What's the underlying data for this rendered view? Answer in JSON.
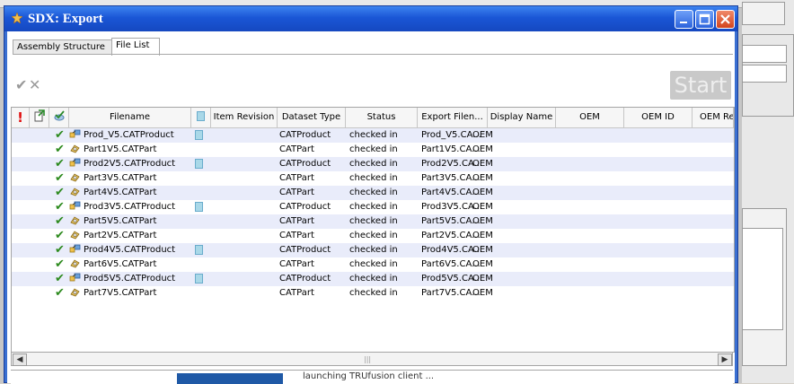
{
  "dialog": {
    "title": "SDX: Export",
    "icons": {
      "app": "star-icon",
      "minimize": "minimize-icon",
      "maximize": "maximize-icon",
      "close": "close-icon"
    }
  },
  "tabs": [
    {
      "label": "Assembly Structure",
      "active": false
    },
    {
      "label": "File List",
      "active": true
    }
  ],
  "toolbar": {
    "check_icon": "check-icon",
    "cross_icon": "cross-icon",
    "start_label": "Start"
  },
  "table": {
    "headers": {
      "filename": "Filename",
      "item_revision": "Item Revision",
      "dataset_type": "Dataset Type",
      "status": "Status",
      "export_filename": "Export Filen...",
      "display_name": "Display Name",
      "oem": "OEM",
      "oem_id": "OEM ID",
      "oem_re": "OEM Re"
    },
    "rows": [
      {
        "filename": "Prod_V5.CATProduct",
        "has_doc": true,
        "dataset_type": "CATProduct",
        "status": "checked in",
        "export": "Prod_V5.CA...",
        "display": "OEM"
      },
      {
        "filename": "Part1V5.CATPart",
        "has_doc": false,
        "dataset_type": "CATPart",
        "status": "checked in",
        "export": "Part1V5.CA...",
        "display": "OEM"
      },
      {
        "filename": "Prod2V5.CATProduct",
        "has_doc": true,
        "dataset_type": "CATProduct",
        "status": "checked in",
        "export": "Prod2V5.CA...",
        "display": "OEM"
      },
      {
        "filename": "Part3V5.CATPart",
        "has_doc": false,
        "dataset_type": "CATPart",
        "status": "checked in",
        "export": "Part3V5.CA...",
        "display": "OEM"
      },
      {
        "filename": "Part4V5.CATPart",
        "has_doc": false,
        "dataset_type": "CATPart",
        "status": "checked in",
        "export": "Part4V5.CA...",
        "display": "OEM"
      },
      {
        "filename": "Prod3V5.CATProduct",
        "has_doc": true,
        "dataset_type": "CATProduct",
        "status": "checked in",
        "export": "Prod3V5.CA...",
        "display": "OEM"
      },
      {
        "filename": "Part5V5.CATPart",
        "has_doc": false,
        "dataset_type": "CATPart",
        "status": "checked in",
        "export": "Part5V5.CA...",
        "display": "OEM"
      },
      {
        "filename": "Part2V5.CATPart",
        "has_doc": false,
        "dataset_type": "CATPart",
        "status": "checked in",
        "export": "Part2V5.CA...",
        "display": "OEM"
      },
      {
        "filename": "Prod4V5.CATProduct",
        "has_doc": true,
        "dataset_type": "CATProduct",
        "status": "checked in",
        "export": "Prod4V5.CA...",
        "display": "OEM"
      },
      {
        "filename": "Part6V5.CATPart",
        "has_doc": false,
        "dataset_type": "CATPart",
        "status": "checked in",
        "export": "Part6V5.CA...",
        "display": "OEM"
      },
      {
        "filename": "Prod5V5.CATProduct",
        "has_doc": true,
        "dataset_type": "CATProduct",
        "status": "checked in",
        "export": "Prod5V5.CA...",
        "display": "OEM"
      },
      {
        "filename": "Part7V5.CATPart",
        "has_doc": false,
        "dataset_type": "CATPart",
        "status": "checked in",
        "export": "Part7V5.CA...",
        "display": "OEM"
      }
    ]
  },
  "status": {
    "message": "launching TRUfusion client ..."
  }
}
